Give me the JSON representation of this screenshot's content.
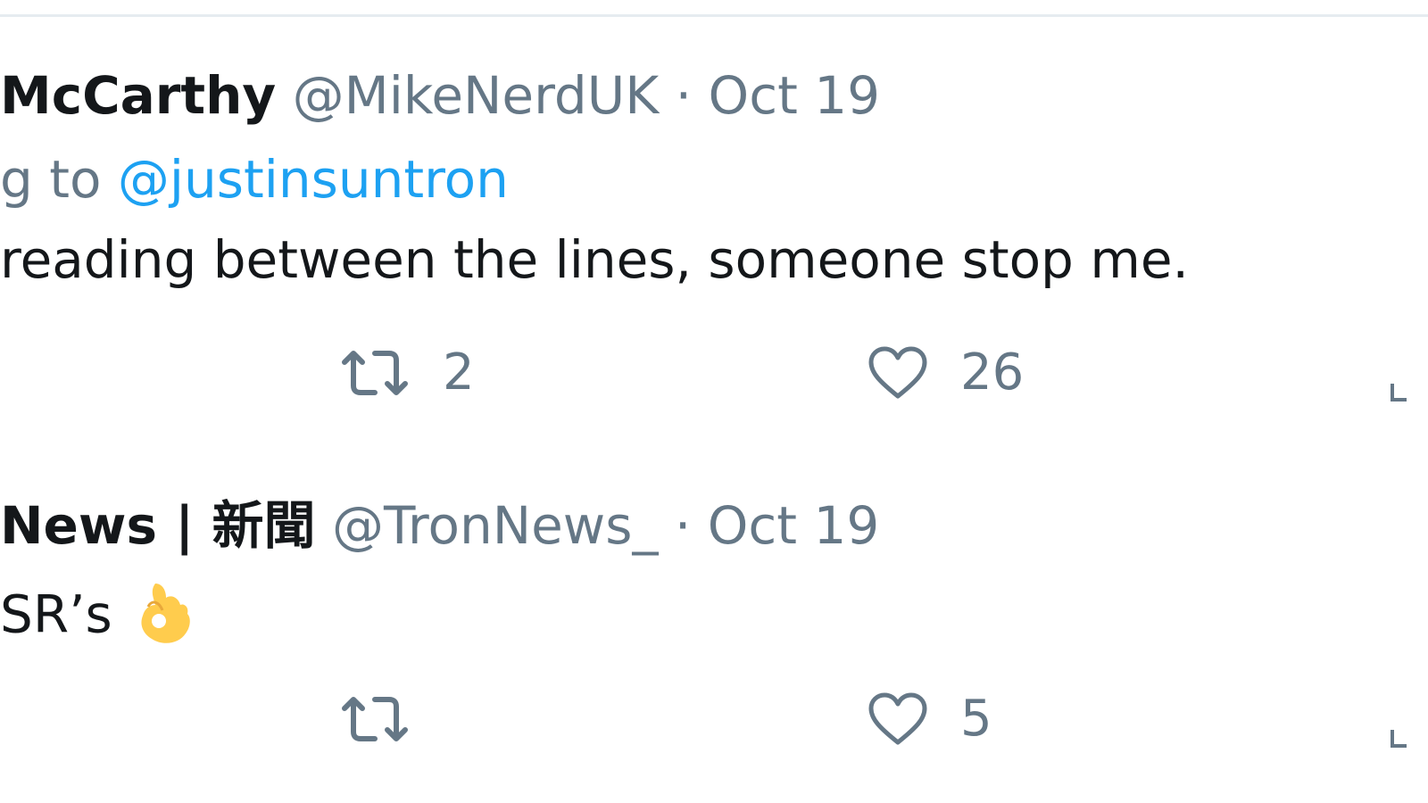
{
  "tweets": [
    {
      "author_name": "McCarthy",
      "handle": "@MikeNerdUK",
      "separator": "·",
      "date": "Oct 19",
      "reply_prefix": "g to",
      "reply_mention": "@justinsuntron",
      "text": "reading between the lines, someone stop me.",
      "retweet_count": "2",
      "like_count": "26"
    },
    {
      "author_name": "News | 新聞",
      "handle": "@TronNews_",
      "separator": "·",
      "date": "Oct 19",
      "text": "SR’s",
      "emoji": "ok-hand-emoji",
      "retweet_count": "",
      "like_count": "5"
    }
  ],
  "icons": {
    "retweet": "retweet-icon",
    "like": "heart-icon",
    "share": "share-icon"
  },
  "colors": {
    "primary_text": "#14171a",
    "secondary_text": "#657786",
    "link": "#1da1f2",
    "divider": "#e6ecf0",
    "emoji": "#ffcc4d"
  }
}
